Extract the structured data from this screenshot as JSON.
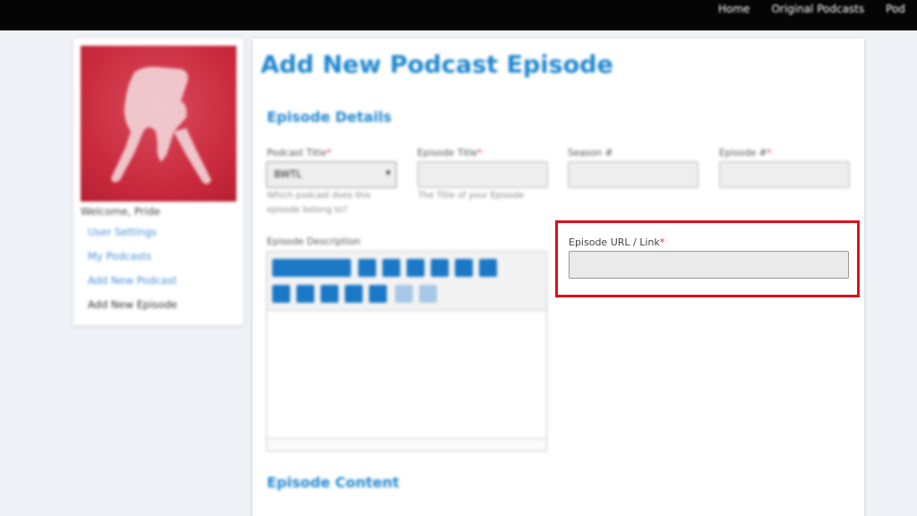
{
  "topnav": {
    "items": [
      "Home",
      "Original Podcasts",
      "Pod"
    ]
  },
  "sidebar": {
    "welcome": "Welcome, Pride",
    "links": [
      "User Settings",
      "My Podcasts",
      "Add New Podcast",
      "Add New Episode"
    ]
  },
  "main": {
    "title": "Add New Podcast Episode",
    "section_details": "Episode Details",
    "section_content": "Episode Content",
    "fields": {
      "podcast_title": {
        "label": "Podcast Title",
        "value": "BWTL",
        "help": "Which podcast does this episode belong to?"
      },
      "episode_title": {
        "label": "Episode Title",
        "help": "The Title of your Episode"
      },
      "season": {
        "label": "Season #"
      },
      "episode_number": {
        "label": "Episode #"
      },
      "description": {
        "label": "Episode Description"
      },
      "episode_url": {
        "label": "Episode URL / Link",
        "value": ""
      }
    },
    "required_marker": "*"
  },
  "colors": {
    "accent": "#1e86cf",
    "highlight": "#e0101a",
    "required": "#e0303a"
  }
}
